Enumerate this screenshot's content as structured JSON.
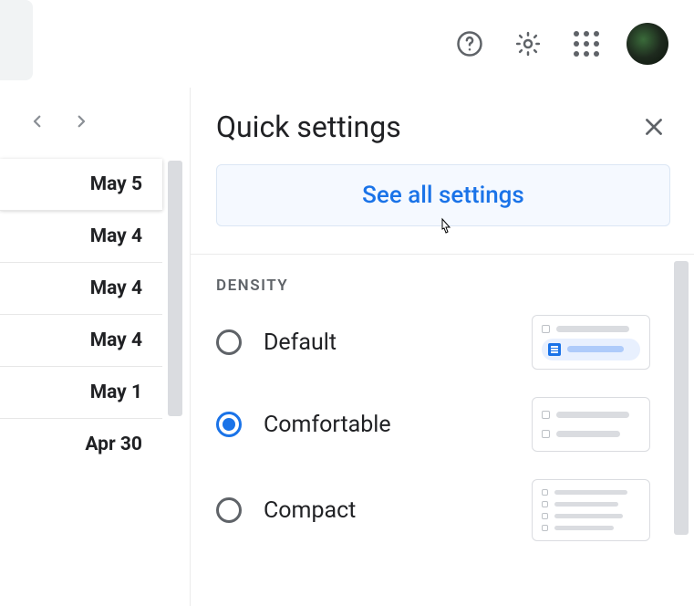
{
  "topbar": {
    "help_icon": "help-icon",
    "settings_icon": "gear-icon",
    "apps_icon": "apps-icon",
    "avatar": "avatar"
  },
  "sidebar": {
    "nav_prev": "chevron-left-icon",
    "nav_next": "chevron-right-icon",
    "dates": [
      {
        "label": "May 5",
        "selected": true
      },
      {
        "label": "May 4",
        "selected": false
      },
      {
        "label": "May 4",
        "selected": false
      },
      {
        "label": "May 4",
        "selected": false
      },
      {
        "label": "May 1",
        "selected": false
      },
      {
        "label": "Apr 30",
        "selected": false
      }
    ]
  },
  "panel": {
    "title": "Quick settings",
    "close_icon": "close-icon",
    "see_all_label": "See all settings",
    "section_density_label": "DENSITY",
    "density_options": [
      {
        "label": "Default",
        "selected": false
      },
      {
        "label": "Comfortable",
        "selected": true
      },
      {
        "label": "Compact",
        "selected": false
      }
    ]
  }
}
